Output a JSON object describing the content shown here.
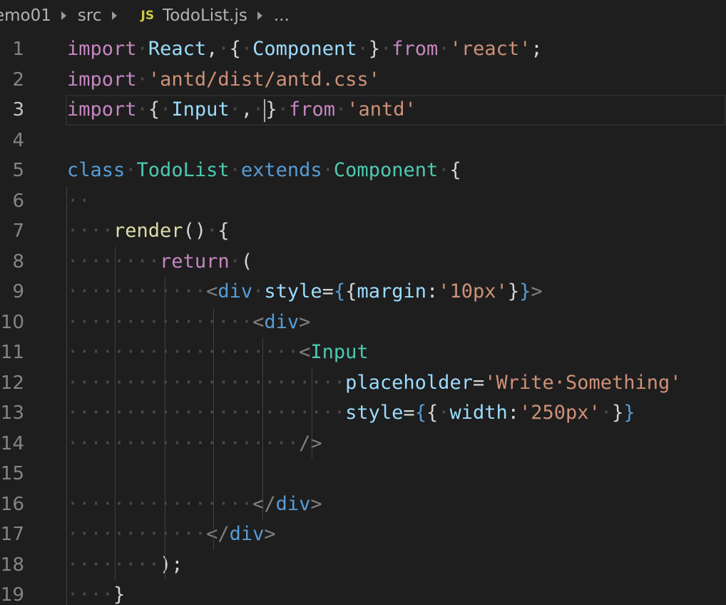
{
  "breadcrumb": {
    "project": "emo01",
    "folder": "src",
    "file_icon": "JS",
    "file": "TodoList.js",
    "more": "..."
  },
  "editor": {
    "current_line": 3,
    "lines": [
      {
        "n": "1",
        "tokens": [
          [
            "kw",
            "import"
          ],
          [
            "ws",
            "·"
          ],
          [
            "var",
            "React"
          ],
          [
            "pun",
            ","
          ],
          [
            "ws",
            "·"
          ],
          [
            "pun",
            "{"
          ],
          [
            "ws",
            "·"
          ],
          [
            "var",
            "Component"
          ],
          [
            "ws",
            "·"
          ],
          [
            "pun",
            "}"
          ],
          [
            "ws",
            "·"
          ],
          [
            "kw",
            "from"
          ],
          [
            "ws",
            "·"
          ],
          [
            "str",
            "'react'"
          ],
          [
            "pun",
            ";"
          ]
        ]
      },
      {
        "n": "2",
        "tokens": [
          [
            "kw",
            "import"
          ],
          [
            "ws",
            "·"
          ],
          [
            "str",
            "'antd/dist/antd.css'"
          ]
        ]
      },
      {
        "n": "3",
        "tokens": [
          [
            "kw",
            "import"
          ],
          [
            "ws",
            "·"
          ],
          [
            "pun",
            "{"
          ],
          [
            "ws",
            "·"
          ],
          [
            "var",
            "Input"
          ],
          [
            "ws",
            "·"
          ],
          [
            "pun",
            ","
          ],
          [
            "ws",
            "·"
          ],
          [
            "caret",
            ""
          ],
          [
            "pun",
            "}"
          ],
          [
            "ws",
            "·"
          ],
          [
            "kw",
            "from"
          ],
          [
            "ws",
            "·"
          ],
          [
            "str",
            "'antd'"
          ]
        ]
      },
      {
        "n": "4",
        "tokens": []
      },
      {
        "n": "5",
        "tokens": [
          [
            "st",
            "class"
          ],
          [
            "ws",
            "·"
          ],
          [
            "cls",
            "TodoList"
          ],
          [
            "ws",
            "·"
          ],
          [
            "st",
            "extends"
          ],
          [
            "ws",
            "·"
          ],
          [
            "cls",
            "Component"
          ],
          [
            "ws",
            "·"
          ],
          [
            "pun",
            "{"
          ]
        ]
      },
      {
        "n": "6",
        "tokens": [
          [
            "ws",
            "··"
          ]
        ]
      },
      {
        "n": "7",
        "tokens": [
          [
            "ws",
            "····"
          ],
          [
            "fn",
            "render"
          ],
          [
            "pun",
            "()"
          ],
          [
            "ws",
            "·"
          ],
          [
            "pun",
            "{"
          ]
        ]
      },
      {
        "n": "8",
        "tokens": [
          [
            "ws",
            "········"
          ],
          [
            "kw",
            "return"
          ],
          [
            "ws",
            "·"
          ],
          [
            "pun",
            "("
          ]
        ]
      },
      {
        "n": "9",
        "tokens": [
          [
            "ws",
            "············"
          ],
          [
            "ang",
            "<"
          ],
          [
            "tag",
            "div"
          ],
          [
            "ws",
            "·"
          ],
          [
            "var",
            "style"
          ],
          [
            "pun",
            "="
          ],
          [
            "brc",
            "{"
          ],
          [
            "pun",
            "{"
          ],
          [
            "var",
            "margin"
          ],
          [
            "pun",
            ":"
          ],
          [
            "str",
            "'10px'"
          ],
          [
            "pun",
            "}"
          ],
          [
            "brc",
            "}"
          ],
          [
            "ang",
            ">"
          ]
        ]
      },
      {
        "n": "10",
        "tokens": [
          [
            "ws",
            "················"
          ],
          [
            "ang",
            "<"
          ],
          [
            "tag",
            "div"
          ],
          [
            "ang",
            ">"
          ]
        ]
      },
      {
        "n": "11",
        "tokens": [
          [
            "ws",
            "····················"
          ],
          [
            "ang",
            "<"
          ],
          [
            "cls",
            "Input"
          ]
        ]
      },
      {
        "n": "12",
        "tokens": [
          [
            "ws",
            "························"
          ],
          [
            "var",
            "placeholder"
          ],
          [
            "pun",
            "="
          ],
          [
            "str",
            "'Write·Something'"
          ]
        ]
      },
      {
        "n": "13",
        "tokens": [
          [
            "ws",
            "························"
          ],
          [
            "var",
            "style"
          ],
          [
            "pun",
            "="
          ],
          [
            "brc",
            "{"
          ],
          [
            "pun",
            "{"
          ],
          [
            "ws",
            "·"
          ],
          [
            "var",
            "width"
          ],
          [
            "pun",
            ":"
          ],
          [
            "str",
            "'250px'"
          ],
          [
            "ws",
            "·"
          ],
          [
            "pun",
            "}"
          ],
          [
            "brc",
            "}"
          ]
        ]
      },
      {
        "n": "14",
        "tokens": [
          [
            "ws",
            "····················"
          ],
          [
            "ang",
            "/>"
          ]
        ]
      },
      {
        "n": "15",
        "tokens": []
      },
      {
        "n": "16",
        "tokens": [
          [
            "ws",
            "················"
          ],
          [
            "ang",
            "</"
          ],
          [
            "tag",
            "div"
          ],
          [
            "ang",
            ">"
          ]
        ]
      },
      {
        "n": "17",
        "tokens": [
          [
            "ws",
            "············"
          ],
          [
            "ang",
            "</"
          ],
          [
            "tag",
            "div"
          ],
          [
            "ang",
            ">"
          ]
        ]
      },
      {
        "n": "18",
        "tokens": [
          [
            "ws",
            "········"
          ],
          [
            "pun",
            ");"
          ]
        ]
      },
      {
        "n": "19",
        "tokens": [
          [
            "ws",
            "····"
          ],
          [
            "pun",
            "}"
          ]
        ]
      }
    ]
  },
  "colors": {
    "background": "#1e1e1e",
    "keyword": "#c586c0",
    "storage": "#569cd6",
    "class": "#4ec9b0",
    "variable": "#9cdcfe",
    "string": "#ce9178",
    "function": "#dcdcaa"
  }
}
